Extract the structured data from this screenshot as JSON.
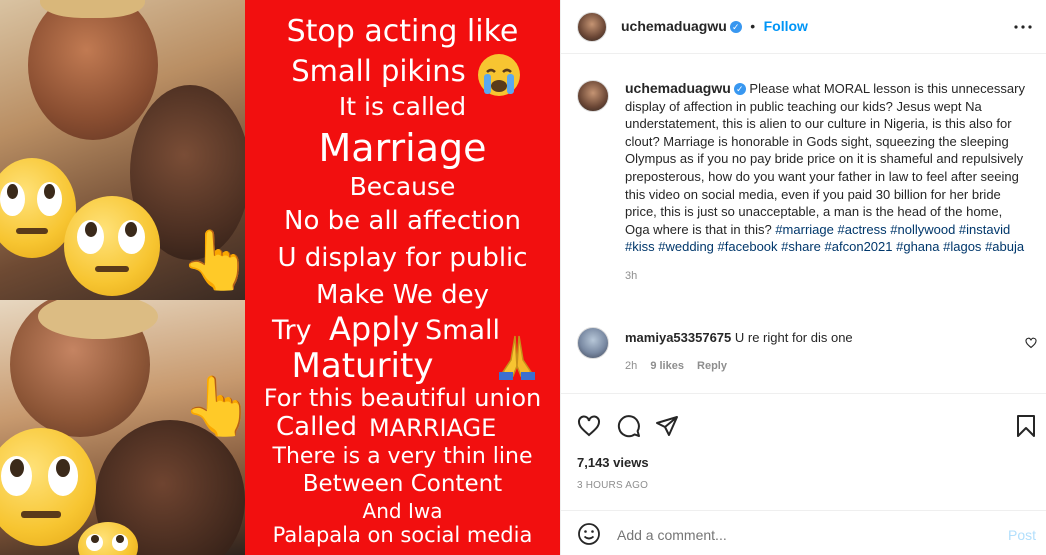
{
  "media": {
    "red_lines": [
      "Stop acting like",
      "Small pikins",
      "It is called",
      "Marriage",
      "Because",
      "No be all affection",
      "U display for public",
      "Make We dey",
      "Try",
      "Apply",
      "Small",
      "Maturity",
      "For this beautiful union",
      "Called",
      "MARRIAGE",
      "There is a very thin line",
      "Between Content",
      "And Iwa",
      "Palapala on social media"
    ],
    "colors": {
      "panel": "#f20f0f",
      "text": "#ffffff"
    }
  },
  "header": {
    "username": "uchemaduagwu",
    "separator": "•",
    "follow_label": "Follow",
    "more_icon": "more-horizontal-icon"
  },
  "caption": {
    "username": "uchemaduagwu",
    "text": "Please what MORAL lesson is this unnecessary display of affection in public teaching our kids? Jesus wept Na understatement, this is alien to our culture in Nigeria, is this also for clout? Marriage is honorable in Gods sight, squeezing the sleeping Olympus as if you no pay bride price on it is shameful and repulsively preposterous, how do you want your father in law to feel after seeing this video on social media, even if you paid 30 billion for her bride price, this is just so unacceptable, a man is the head of the home, Oga where is that in this?",
    "hashtags": [
      "#marriage",
      "#actress",
      "#nollywood",
      "#instavid",
      "#kiss",
      "#wedding",
      "#facebook",
      "#share",
      "#afcon2021",
      "#ghana",
      "#lagos",
      "#abuja"
    ],
    "time": "3h"
  },
  "comment": {
    "username": "mamiya53357675",
    "text": "U re right for dis one",
    "time": "2h",
    "likes": "9 likes",
    "reply_label": "Reply"
  },
  "stats": {
    "views": "7,143 views",
    "posted": "3 HOURS AGO"
  },
  "add_comment": {
    "placeholder": "Add a comment...",
    "post_label": "Post"
  },
  "colors": {
    "link": "#0095f6",
    "hashtag": "#00376b",
    "muted": "#8e8e8e",
    "verified": "#3897f0"
  }
}
